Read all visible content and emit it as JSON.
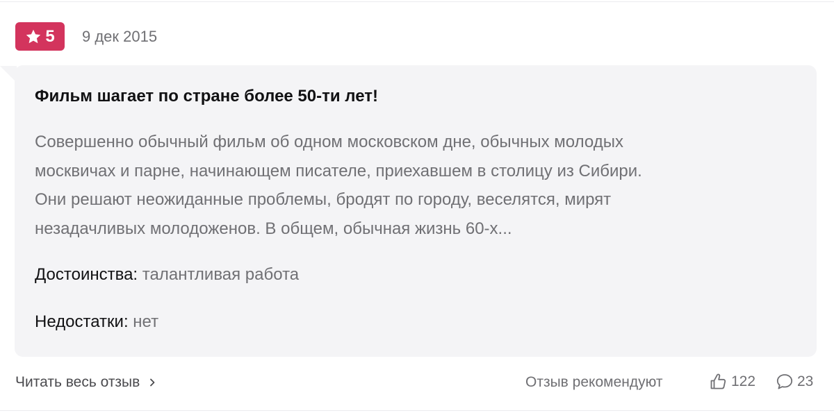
{
  "header": {
    "rating": "5",
    "date": "9 дек 2015"
  },
  "review": {
    "title": "Фильм шагает по стране более 50-ти лет!",
    "text_lines": [
      "Совершенно обычный фильм об одном московском дне, обычных молодых",
      "москвичах и парне, начинающем писателе, приехавшем в столицу из Сибири.",
      "Они решают неожиданные проблемы, бродят по городу, веселятся, мирят",
      "незадачливых молодоженов. В общем, обычная жизнь 60-х..."
    ],
    "pros_label": "Достоинства:",
    "pros_value": "талантливая работа",
    "cons_label": "Недостатки:",
    "cons_value": "нет"
  },
  "footer": {
    "read_more": "Читать весь отзыв",
    "recommend": "Отзыв рекомендуют",
    "likes": "122",
    "comments": "23"
  },
  "icons": {
    "star": "star-icon",
    "chevron": "chevron-right-icon",
    "like": "thumbs-up-icon",
    "comment": "comment-icon"
  },
  "colors": {
    "badge": "#d3345d",
    "bubble": "#f4f4f6",
    "muted_text": "#707074",
    "dark_text": "#111113"
  }
}
